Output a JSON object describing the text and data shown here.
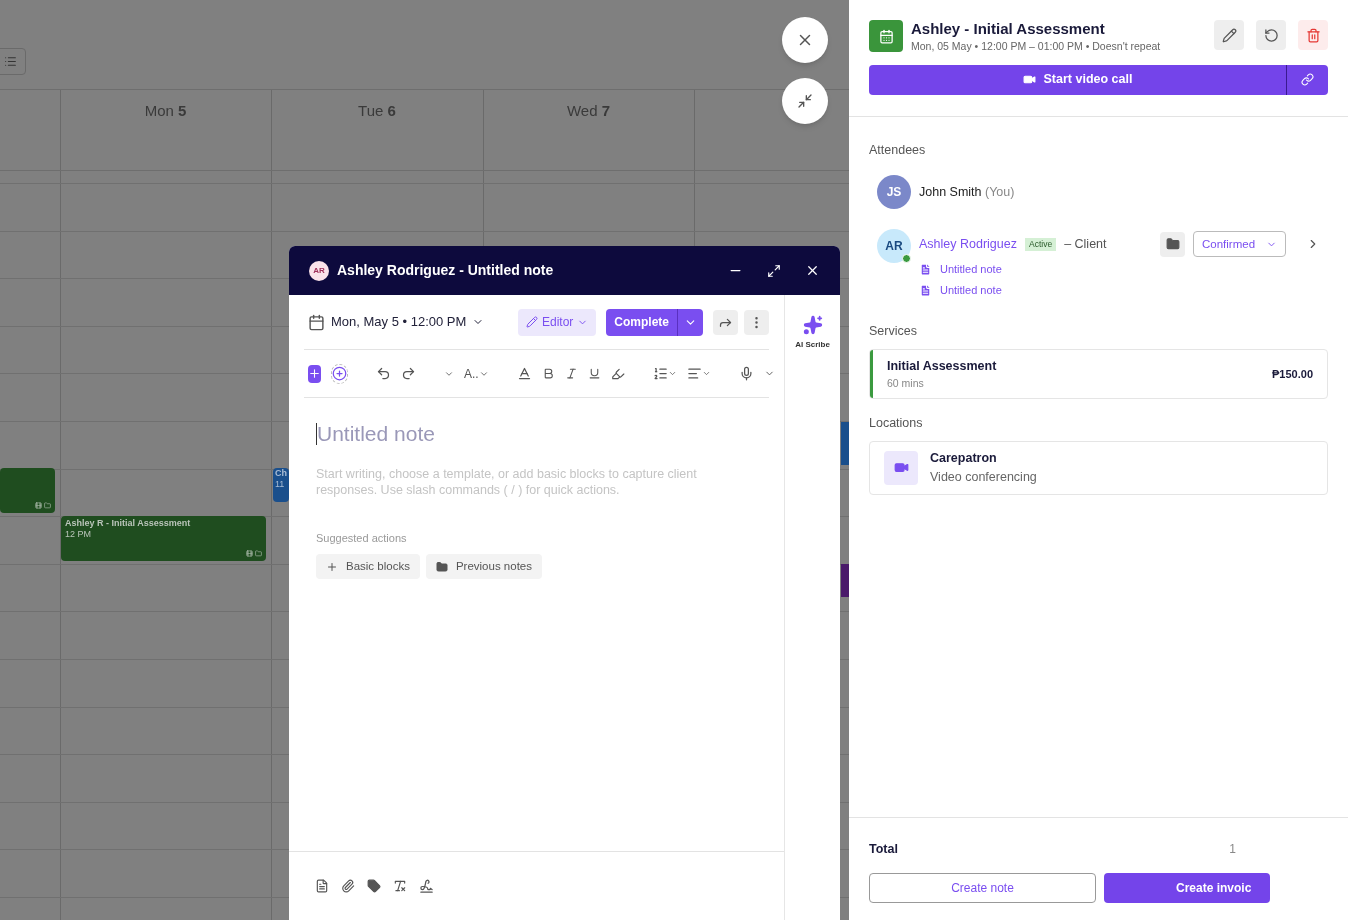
{
  "calendar": {
    "days": [
      {
        "weekday": "Mon",
        "day": "5"
      },
      {
        "weekday": "Tue",
        "day": "6"
      },
      {
        "weekday": "Wed",
        "day": "7"
      }
    ],
    "events": [
      {
        "kind": "block",
        "color": "#1f4d1f"
      },
      {
        "kind": "block",
        "color": "#1f4d1f",
        "title": "Ashley R - Initial Assessment",
        "time": "12 PM"
      },
      {
        "kind": "sliver",
        "color": "#1a4f8c",
        "title": "Ch",
        "time": "11"
      },
      {
        "kind": "edge",
        "color": "#1a4f8c"
      },
      {
        "kind": "edge",
        "color": "#4a1a6a"
      }
    ]
  },
  "note": {
    "avatar": "AR",
    "title": "Ashley Rodriguez - Untitled note",
    "date": "Mon, May 5 • 12:00 PM",
    "mode": "Editor",
    "complete": "Complete",
    "ai_label": "AI Scribe",
    "font_size": "A..",
    "heading_placeholder": "Untitled note",
    "body_placeholder": "Start writing, choose a template, or add basic blocks to capture client responses. Use slash commands ( / ) for quick actions.",
    "suggested_label": "Suggested actions",
    "actions": [
      {
        "kind": "plus",
        "label": "Basic blocks"
      },
      {
        "kind": "notes",
        "label": "Previous notes"
      }
    ]
  },
  "appointment": {
    "title": "Ashley - Initial Assessment",
    "subtitle": "Mon, 05 May • 12:00 PM – 01:00 PM • Doesn't repeat",
    "video_call": "Start video call",
    "attendees_label": "Attendees",
    "attendees": [
      {
        "initials": "JS",
        "name": "John Smith",
        "suffix": "(You)",
        "kind": "staff",
        "online": false
      },
      {
        "initials": "AR",
        "name": "Ashley Rodriguez",
        "badge": "Active",
        "role": "– Client",
        "kind": "client",
        "online": true,
        "status": "Confirmed",
        "notes": [
          "Untitled note",
          "Untitled note"
        ]
      }
    ],
    "services_label": "Services",
    "service": {
      "name": "Initial Assessment",
      "duration": "60 mins",
      "price": "₱150.00",
      "color": "#3b9a3f"
    },
    "locations_label": "Locations",
    "location": {
      "name": "Carepatron",
      "type": "Video conferencing"
    },
    "total_label": "Total",
    "total": "1",
    "create_note": "Create note",
    "create_invoice": "Create invoic"
  }
}
